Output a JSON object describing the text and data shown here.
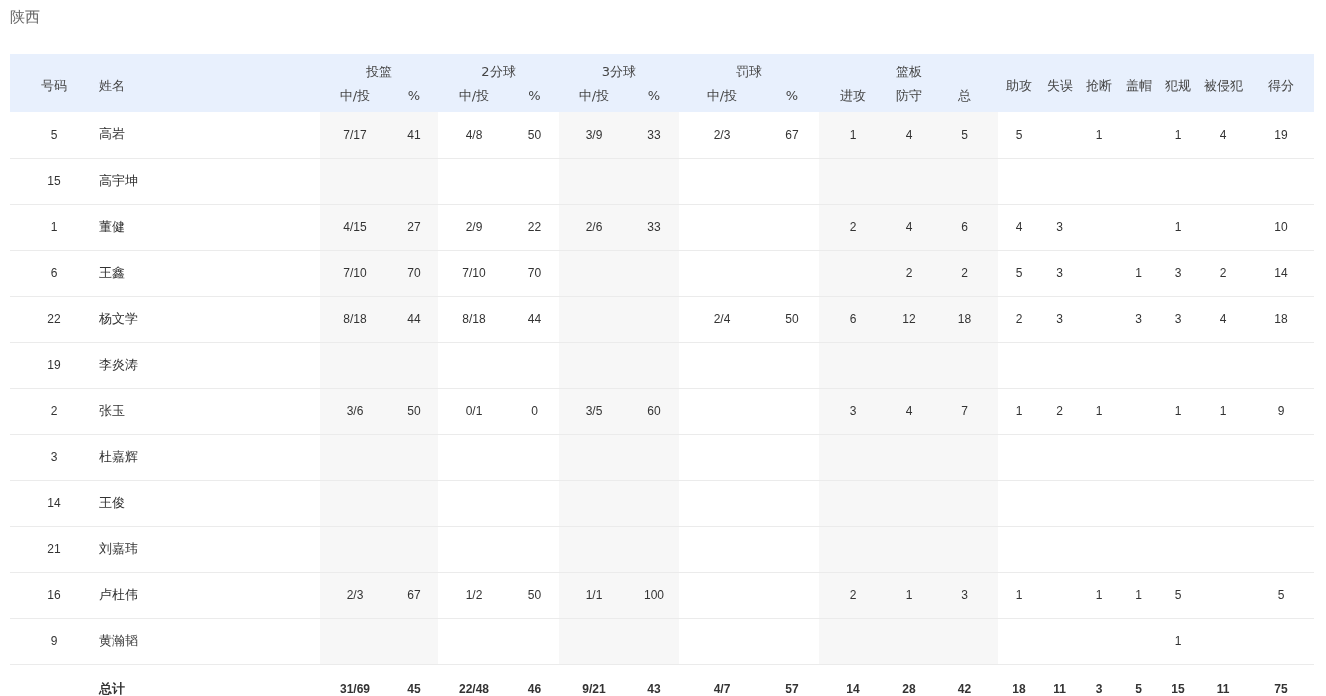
{
  "team": {
    "title": "陕西"
  },
  "table": {
    "columns": [
      {
        "label": "号码"
      },
      {
        "label": "姓名"
      },
      {
        "label": "投篮",
        "shaded": true,
        "sub": [
          "中/投",
          "%"
        ]
      },
      {
        "label": "2分球",
        "shaded": false,
        "sub": [
          "中/投",
          "%"
        ]
      },
      {
        "label": "3分球",
        "shaded": true,
        "sub": [
          "中/投",
          "%"
        ]
      },
      {
        "label": "罚球",
        "shaded": false,
        "sub": [
          "中/投",
          "%"
        ]
      },
      {
        "label": "篮板",
        "shaded": true,
        "sub": [
          "进攻",
          "防守",
          "总"
        ]
      },
      {
        "label": "助攻"
      },
      {
        "label": "失误"
      },
      {
        "label": "抢断"
      },
      {
        "label": "盖帽"
      },
      {
        "label": "犯规"
      },
      {
        "label": "被侵犯"
      },
      {
        "label": "得分"
      }
    ],
    "rows": [
      {
        "kind": "player",
        "number": "5",
        "name": "高岩",
        "fg": "7/17",
        "fg_pct": "41",
        "p2": "4/8",
        "p2_pct": "50",
        "p3": "3/9",
        "p3_pct": "33",
        "ft": "2/3",
        "ft_pct": "67",
        "oreb": "1",
        "dreb": "4",
        "reb": "5",
        "ast": "5",
        "stl": "1",
        "pf": "1",
        "fd": "4",
        "pts": "19"
      },
      {
        "kind": "player",
        "number": "15",
        "name": "高宇坤"
      },
      {
        "kind": "player",
        "number": "1",
        "name": "董健",
        "fg": "4/15",
        "fg_pct": "27",
        "p2": "2/9",
        "p2_pct": "22",
        "p3": "2/6",
        "p3_pct": "33",
        "oreb": "2",
        "dreb": "4",
        "reb": "6",
        "ast": "4",
        "tov": "3",
        "pf": "1",
        "pts": "10"
      },
      {
        "kind": "player",
        "number": "6",
        "name": "王鑫",
        "fg": "7/10",
        "fg_pct": "70",
        "p2": "7/10",
        "p2_pct": "70",
        "dreb": "2",
        "reb": "2",
        "ast": "5",
        "tov": "3",
        "blk": "1",
        "pf": "3",
        "fd": "2",
        "pts": "14"
      },
      {
        "kind": "player",
        "number": "22",
        "name": "杨文学",
        "fg": "8/18",
        "fg_pct": "44",
        "p2": "8/18",
        "p2_pct": "44",
        "ft": "2/4",
        "ft_pct": "50",
        "oreb": "6",
        "dreb": "12",
        "reb": "18",
        "ast": "2",
        "tov": "3",
        "blk": "3",
        "pf": "3",
        "fd": "4",
        "pts": "18"
      },
      {
        "kind": "player",
        "number": "19",
        "name": "李炎涛"
      },
      {
        "kind": "player",
        "number": "2",
        "name": "张玉",
        "fg": "3/6",
        "fg_pct": "50",
        "p2": "0/1",
        "p2_pct": "0",
        "p3": "3/5",
        "p3_pct": "60",
        "oreb": "3",
        "dreb": "4",
        "reb": "7",
        "ast": "1",
        "tov": "2",
        "stl": "1",
        "pf": "1",
        "fd": "1",
        "pts": "9"
      },
      {
        "kind": "player",
        "number": "3",
        "name": "杜嘉辉"
      },
      {
        "kind": "player",
        "number": "14",
        "name": "王俊"
      },
      {
        "kind": "player",
        "number": "21",
        "name": "刘嘉玮"
      },
      {
        "kind": "player",
        "number": "16",
        "name": "卢杜伟",
        "fg": "2/3",
        "fg_pct": "67",
        "p2": "1/2",
        "p2_pct": "50",
        "p3": "1/1",
        "p3_pct": "100",
        "oreb": "2",
        "dreb": "1",
        "reb": "3",
        "ast": "1",
        "stl": "1",
        "blk": "1",
        "pf": "5",
        "pts": "5"
      },
      {
        "kind": "player",
        "number": "9",
        "name": "黄瀚韬",
        "pf": "1"
      },
      {
        "kind": "total",
        "name": "总计",
        "fg": "31/69",
        "fg_pct": "45",
        "p2": "22/48",
        "p2_pct": "46",
        "p3": "9/21",
        "p3_pct": "43",
        "ft": "4/7",
        "ft_pct": "57",
        "oreb": "14",
        "dreb": "28",
        "reb": "42",
        "ast": "18",
        "tov": "11",
        "stl": "3",
        "blk": "5",
        "pf": "15",
        "fd": "11",
        "pts": "75"
      }
    ]
  }
}
